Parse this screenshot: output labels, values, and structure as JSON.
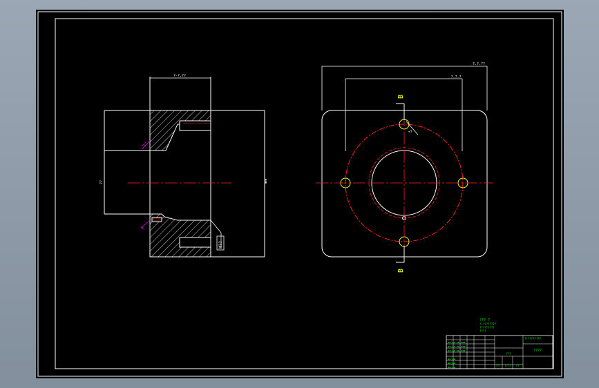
{
  "drawing": {
    "colors": {
      "background": "#000000",
      "viewport": "#8e9aa8",
      "outline": "#ffffff",
      "centerline": "#ff2020",
      "hidden_holes": "#ffff00",
      "section_labels": "#ffff00",
      "annotations": "#ff00ff",
      "title_block": "#00ff00"
    },
    "section_view": {
      "top_dimension": "?-?.??",
      "left_dimension": "??",
      "left_chamfer_label": "?°",
      "lower_chamfer_label": "?",
      "thread_callout": "M??"
    },
    "plan_view": {
      "outer_dimension": "?.?.??",
      "inner_dimension": "?.?.?",
      "section_marker_top": "B",
      "section_marker_bottom": "B",
      "hole_label": "?x"
    },
    "technical_notes": [
      "???  ?",
      "?.????????",
      "?????????",
      "????"
    ],
    "title_block": {
      "project_label": "??????????",
      "part_name": "????",
      "drawing_number": "???",
      "scale_label": "???",
      "material_label": "????",
      "sheet_label": "??"
    }
  }
}
